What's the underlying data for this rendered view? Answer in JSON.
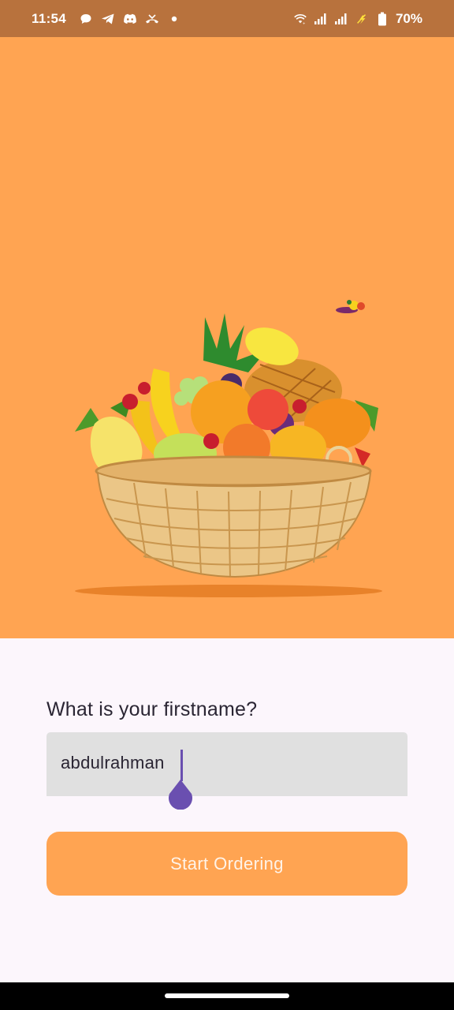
{
  "status_bar": {
    "time": "11:54",
    "battery": "70%",
    "left_icons": [
      "chat-icon",
      "telegram-icon",
      "discord-icon",
      "missed-call-icon",
      "dot-icon"
    ],
    "right_icons": [
      "wifi-icon",
      "signal-icon",
      "signal-icon",
      "charging-icon",
      "battery-icon"
    ]
  },
  "hero": {
    "background_color": "#FFA452",
    "image": "fruit-basket-illustration"
  },
  "form": {
    "question": "What is your firstname?",
    "name_value": "abdulrahman",
    "accent_color": "#6A4FB0"
  },
  "actions": {
    "start_label": "Start Ordering",
    "button_color": "#FFA452"
  }
}
